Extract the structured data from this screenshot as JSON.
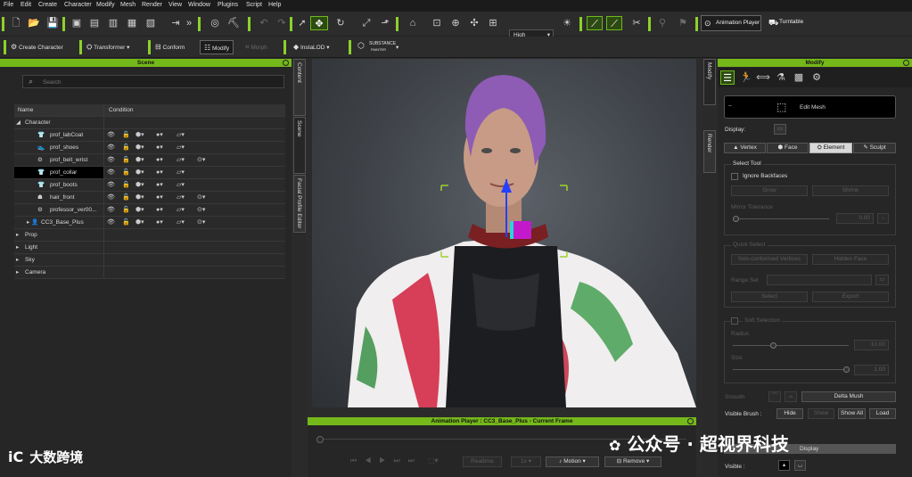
{
  "menubar": {
    "items": [
      "File",
      "Edit",
      "Create",
      "Character",
      "Modify",
      "Mesh",
      "Render",
      "View",
      "Window",
      "Plugins",
      "Script",
      "Help"
    ]
  },
  "toolbar": {
    "quality": "High",
    "animation_player_label": "Animation Player",
    "turntable_label": "Turntable",
    "create_character_label": "Create Character",
    "transformer_label": "Transformer",
    "conform_label": "Conform",
    "modify_label": "Modify",
    "morph_label": "Morph",
    "instalod_label": "InstaLOD",
    "substance_line1": "SUBSTANCE",
    "substance_line2": "PAINTER"
  },
  "scene": {
    "title": "Scene",
    "search_placeholder": "Search",
    "col_name": "Name",
    "col_condition": "Condition",
    "rows": [
      {
        "name": "Character",
        "level": 0,
        "type": "group"
      },
      {
        "name": "prof_labCoat",
        "level": 2,
        "type": "cloth"
      },
      {
        "name": "prof_shoes",
        "level": 2,
        "type": "shoe"
      },
      {
        "name": "prof_belt_wrist",
        "level": 2,
        "type": "acc"
      },
      {
        "name": "prof_collar",
        "level": 2,
        "type": "cloth",
        "selected": true
      },
      {
        "name": "prof_boots",
        "level": 2,
        "type": "cloth"
      },
      {
        "name": "hair_front",
        "level": 2,
        "type": "hair"
      },
      {
        "name": "professor_ver00...",
        "level": 2,
        "type": "acc"
      },
      {
        "name": "CC3_Base_Plus",
        "level": 1,
        "type": "body"
      },
      {
        "name": "Prop",
        "level": 0,
        "type": "group"
      },
      {
        "name": "Light",
        "level": 0,
        "type": "group"
      },
      {
        "name": "Sky",
        "level": 0,
        "type": "group"
      },
      {
        "name": "Camera",
        "level": 0,
        "type": "group"
      }
    ],
    "side_tabs": [
      "Content",
      "Scene",
      "Facial Profile Editor"
    ]
  },
  "anim": {
    "title": "Animation Player : CC3_Base_Plus - Current Frame",
    "realtime": "Realtime",
    "speed": "1x",
    "motion": "Motion",
    "remove": "Remove"
  },
  "modify": {
    "title": "Modify",
    "edit_mesh": "Edit Mesh",
    "display_label": "Display:",
    "modes": [
      "Vertex",
      "Face",
      "Element",
      "Sculpt"
    ],
    "select_tool": "Select Tool",
    "ignore_backfaces": "Ignore Backfaces",
    "grow": "Grow",
    "shrink": "Shrink",
    "mirror_tolerance": "Mirror Tolerance",
    "mirror_value": "0.00",
    "quick_select": "Quick Select",
    "non_conformed": "Non-conformed Vertices",
    "hidden_face": "Hidden Face",
    "range_set": "Range Set",
    "select": "Select",
    "export": "Export",
    "soft_selection": "Soft Selection",
    "radius": "Radius",
    "radius_value": "10.00",
    "size": "Size",
    "size_value": "1.00",
    "smooth": "Smooth",
    "delta_mush": "Delta Mush",
    "visible_brush": "Visible Brush :",
    "hide": "Hide",
    "show": "Show",
    "show_all": "Show All",
    "load": "Load",
    "display_section": "Display",
    "visible": "Visible :",
    "side_tabs": [
      "Modify",
      "Render"
    ]
  },
  "watermark": {
    "left_logo": "iC",
    "left": "大数跨境",
    "right": "公众号 · 超视界科技"
  }
}
